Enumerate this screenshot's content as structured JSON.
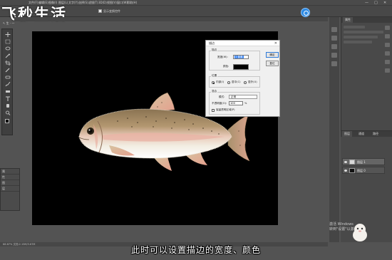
{
  "brand": {
    "text": "飞秒生活",
    "subtext": "↖ 生 · 一"
  },
  "menubar": {
    "items": [
      "文件(F)",
      "编辑(E)",
      "图像(I)",
      "图层(L)",
      "文字(Y)",
      "选择(S)",
      "滤镜(T)",
      "3D(D)",
      "视图(V)",
      "窗口(W)",
      "帮助(H)"
    ],
    "window_controls": [
      "—",
      "□",
      "✕"
    ]
  },
  "options_bar": {
    "checkbox_label": "显示变换控件",
    "checked": true
  },
  "dialog": {
    "title": "描边",
    "close": "✕",
    "section_stroke": "描边",
    "width_label": "宽度(W):",
    "width_value": "3 像素",
    "color_label": "颜色:",
    "color_value": "#000000",
    "section_position": "位置",
    "position_options": [
      "内部(I)",
      "居中(C)",
      "居外(U)"
    ],
    "position_selected": 0,
    "section_blend": "混合",
    "mode_label": "模式:",
    "mode_value": "正常",
    "opacity_label": "不透明度(O):",
    "opacity_value": "100",
    "opacity_unit": "%",
    "preserve_label": "保留透明区域(P)",
    "ok_label": "确定",
    "cancel_label": "复位"
  },
  "right_panel": {
    "tabs": [
      "属性"
    ],
    "layers_tabs": [
      "图层",
      "通道",
      "路径"
    ],
    "layers": [
      {
        "name": "图层 1",
        "thumb_color": "#d8d8d8",
        "active": true
      },
      {
        "name": "图层 0",
        "thumb_color": "#111111",
        "active": false
      }
    ]
  },
  "left_panel": {
    "rows": [
      "属",
      "性",
      "图",
      "层"
    ]
  },
  "status_bar": {
    "text": "66.67%   文档:2.15M/3.67M"
  },
  "watermark": {
    "line1": "激活 Windows",
    "line2": "转到\"设置\"以激活"
  },
  "caption": "此时可以设置描边的宽度、颜色",
  "colors": {
    "app_bg": "#535353",
    "canvas": "#000000",
    "accent_blue": "#2d8ae3",
    "dialog_bg": "#f0f0f0",
    "fish_body": "#b39770",
    "fish_belly": "#f2ede2",
    "fish_fin": "#e5a08e"
  },
  "icons": [
    "photoshop-logo-icon",
    "marquee-tool-icon",
    "lasso-tool-icon",
    "crop-tool-icon",
    "brush-tool-icon",
    "eraser-tool-icon",
    "text-tool-icon",
    "hand-tool-icon",
    "zoom-tool-icon",
    "eye-icon"
  ]
}
